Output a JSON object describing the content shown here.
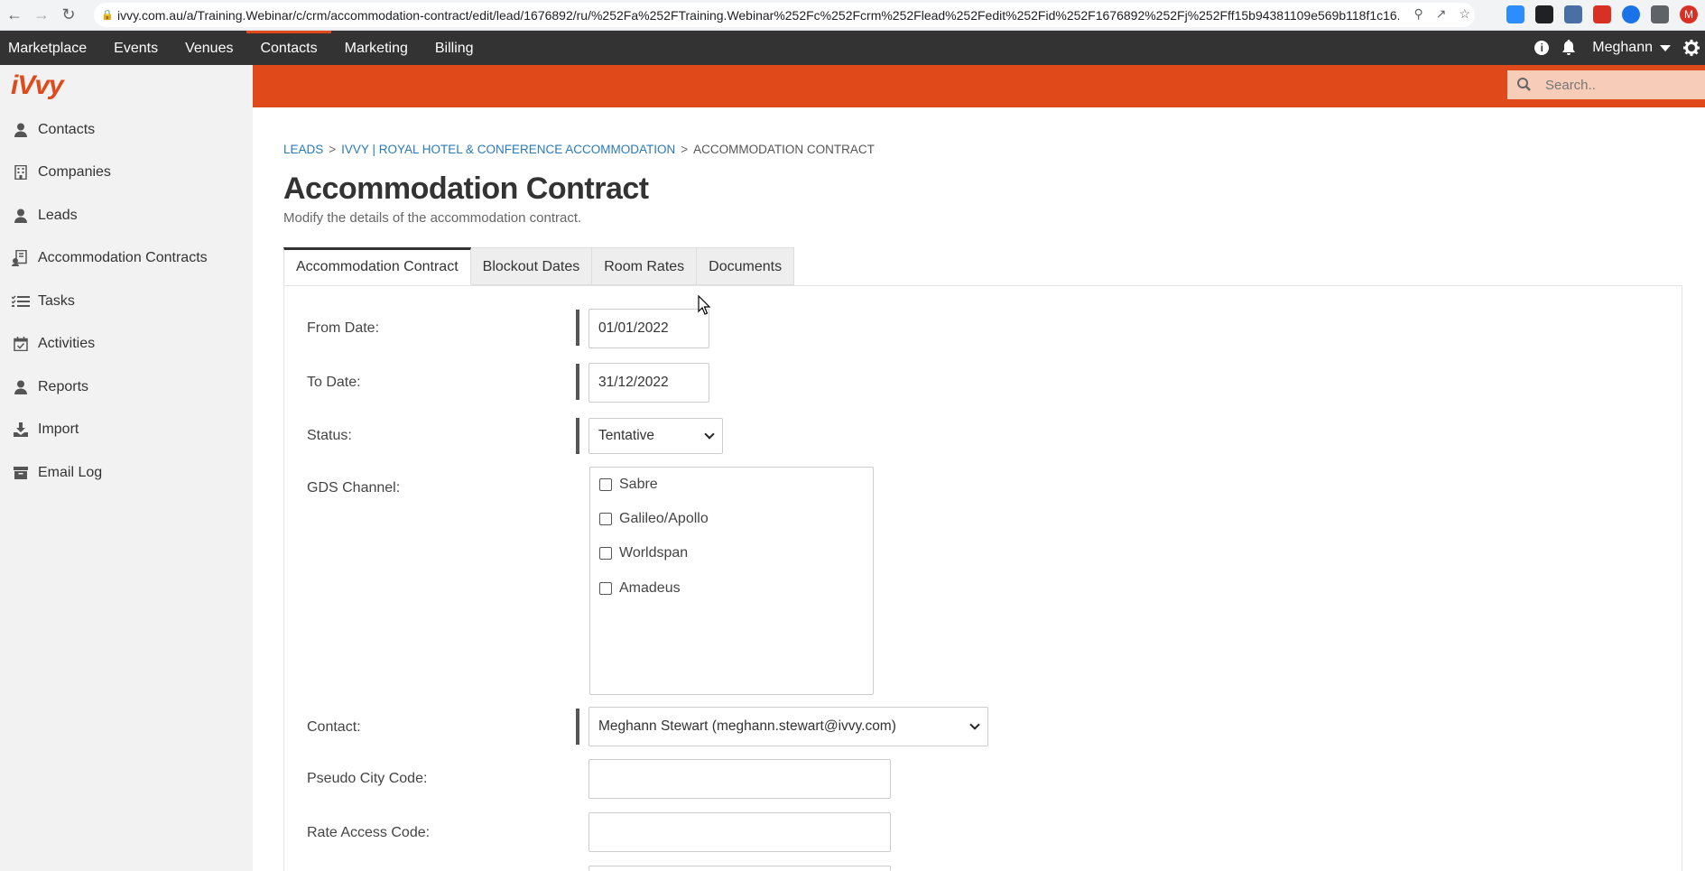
{
  "browser": {
    "url": "ivvy.com.au/a/Training.Webinar/c/crm/accommodation-contract/edit/lead/1676892/ru/%252Fa%252FTraining.Webinar%252Fc%252Fcrm%252Flead%252Fedit%252Fid%252F1676892%252Fj%252Fff15b94381109e569b118f1c16...",
    "profile_initial": "M"
  },
  "topnav": {
    "items": [
      "Marketplace",
      "Events",
      "Venues",
      "Contacts",
      "Marketing",
      "Billing"
    ],
    "active": "Contacts",
    "user": "Meghann"
  },
  "sidebar": {
    "logo": "iVvy",
    "items": [
      {
        "label": "Contacts",
        "icon": "person-icon"
      },
      {
        "label": "Companies",
        "icon": "building-icon"
      },
      {
        "label": "Leads",
        "icon": "person-icon"
      },
      {
        "label": "Accommodation Contracts",
        "icon": "contract-icon"
      },
      {
        "label": "Tasks",
        "icon": "checklist-icon"
      },
      {
        "label": "Activities",
        "icon": "calendar-check-icon"
      },
      {
        "label": "Reports",
        "icon": "person-icon"
      },
      {
        "label": "Import",
        "icon": "download-icon"
      },
      {
        "label": "Email Log",
        "icon": "archive-icon"
      }
    ]
  },
  "search": {
    "placeholder": "Search.."
  },
  "breadcrumb": {
    "items": [
      "LEADS",
      "IVVY | ROYAL HOTEL & CONFERENCE ACCOMMODATION",
      "ACCOMMODATION CONTRACT"
    ],
    "separator": ">"
  },
  "page": {
    "title": "Accommodation Contract",
    "subtitle": "Modify the details of the accommodation contract."
  },
  "tabs": [
    "Accommodation Contract",
    "Blockout Dates",
    "Room Rates",
    "Documents"
  ],
  "form": {
    "from_date": {
      "label": "From Date:",
      "value": "01/01/2022"
    },
    "to_date": {
      "label": "To Date:",
      "value": "31/12/2022"
    },
    "status": {
      "label": "Status:",
      "value": "Tentative"
    },
    "gds": {
      "label": "GDS Channel:",
      "options": [
        "Sabre",
        "Galileo/Apollo",
        "Worldspan",
        "Amadeus"
      ]
    },
    "contact": {
      "label": "Contact:",
      "value": "Meghann Stewart (meghann.stewart@ivvy.com)"
    },
    "pseudo_city_code": {
      "label": "Pseudo City Code:",
      "value": ""
    },
    "rate_access_code": {
      "label": "Rate Access Code:",
      "value": ""
    }
  },
  "colors": {
    "accent": "#e0491a",
    "topnav_bg": "#333333",
    "link": "#2a7ab8"
  }
}
